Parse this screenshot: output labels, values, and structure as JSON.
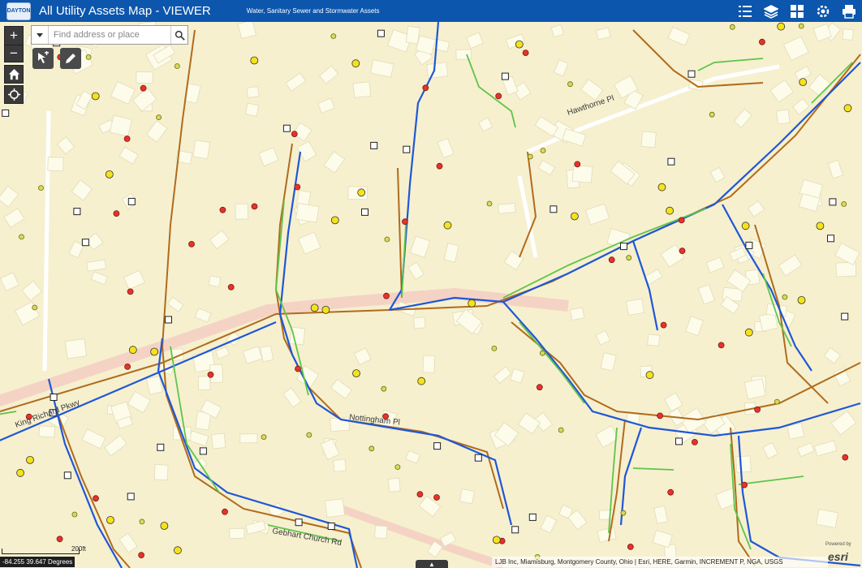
{
  "header": {
    "logo_text": "DAYTON",
    "title": "All Utility Assets Map - VIEWER",
    "subtitle": "Water, Sanitary Sewer and Stormwater Assets",
    "tools": [
      "legend-icon",
      "layers-icon",
      "basemap-gallery-icon",
      "settings-icon",
      "print-icon"
    ]
  },
  "search": {
    "placeholder": "Find address or place"
  },
  "controls": {
    "zoom_in": "+",
    "zoom_out": "−"
  },
  "map": {
    "street_labels": [
      {
        "text": "King Richard Pkwy"
      },
      {
        "text": "Gebhart Church Rd"
      },
      {
        "text": "Nottingham Pl"
      },
      {
        "text": "Hawthorne Pl"
      }
    ],
    "colors": {
      "background": "#f6f0cf",
      "building": "#fdfbea",
      "water_main": "#1f57d6",
      "sewer_main": "#b06b1c",
      "storm_main": "#5fc44a",
      "road": "#f4d3c4"
    }
  },
  "scale": {
    "label": "200ft"
  },
  "coordinates": "-84.255 39.647 Degrees",
  "attribution": "LJB Inc, Miamisburg, Montgomery County, Ohio | Esri, HERE, Garmin, INCREMENT P, NGA, USGS",
  "powered_by": "Powered by",
  "esri_logo": "esri",
  "expand_label": "▲"
}
